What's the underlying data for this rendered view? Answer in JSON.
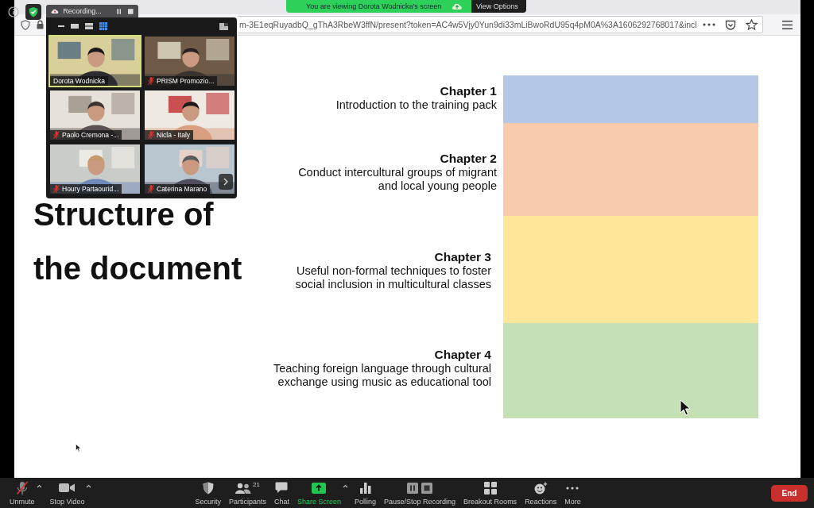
{
  "browser": {
    "url": "m-3E1eqRuyadbQ_gThA3RbeW3ffN/present?token=AC4w5Vjy0Yun9di33mLiBwoRdU95q4pM0A%3A1606292768017&incl"
  },
  "share_banner": {
    "text": "You are viewing Dorota Wodnicka's screen",
    "button": "View Options"
  },
  "recording": {
    "label": "Recording..."
  },
  "gallery": {
    "tiles": [
      {
        "name": "Dorota Wodnicka",
        "muted": false,
        "selected": true
      },
      {
        "name": "PRISM Promozio...",
        "muted": true,
        "selected": false
      },
      {
        "name": "Paolo Cremona -...",
        "muted": true,
        "selected": false
      },
      {
        "name": "Nicla - Italy",
        "muted": true,
        "selected": false
      },
      {
        "name": "Houry Partaourid...",
        "muted": true,
        "selected": false
      },
      {
        "name": "Caterina Marano",
        "muted": true,
        "selected": false
      }
    ]
  },
  "slide": {
    "title_lines": [
      "Structure of",
      "the document"
    ],
    "chapters": [
      {
        "heading": "Chapter 1",
        "text": "Introduction to the training pack",
        "color": "#b4c7e7"
      },
      {
        "heading": "Chapter 2",
        "text": "Conduct intercultural groups of migrant\nand local young people",
        "color": "#f8cbad"
      },
      {
        "heading": "Chapter 3",
        "text": "Useful non-formal techniques to foster\nsocial inclusion in multicultural classes",
        "color": "#ffe699"
      },
      {
        "heading": "Chapter 4",
        "text": "Teaching foreign language through cultural\nexchange using music as educational tool",
        "color": "#c5e0b4"
      }
    ]
  },
  "toolbar": {
    "left": [
      {
        "kind": "mic-muted",
        "label": "Unmute",
        "caret": true
      },
      {
        "kind": "video",
        "label": "Stop Video",
        "caret": true
      }
    ],
    "center": [
      {
        "kind": "shield",
        "label": "Security",
        "caret": false
      },
      {
        "kind": "people",
        "label": "Participants",
        "count": "21",
        "caret": false
      },
      {
        "kind": "chat",
        "label": "Chat",
        "caret": false
      },
      {
        "kind": "share",
        "label": "Share Screen",
        "caret": true
      },
      {
        "kind": "poll",
        "label": "Polling",
        "caret": false
      },
      {
        "kind": "record",
        "label": "Pause/Stop Recording",
        "caret": false
      },
      {
        "kind": "rooms",
        "label": "Breakout Rooms",
        "caret": false
      },
      {
        "kind": "react",
        "label": "Reactions",
        "caret": false
      },
      {
        "kind": "more",
        "label": "More",
        "caret": false
      }
    ],
    "end": "End"
  }
}
